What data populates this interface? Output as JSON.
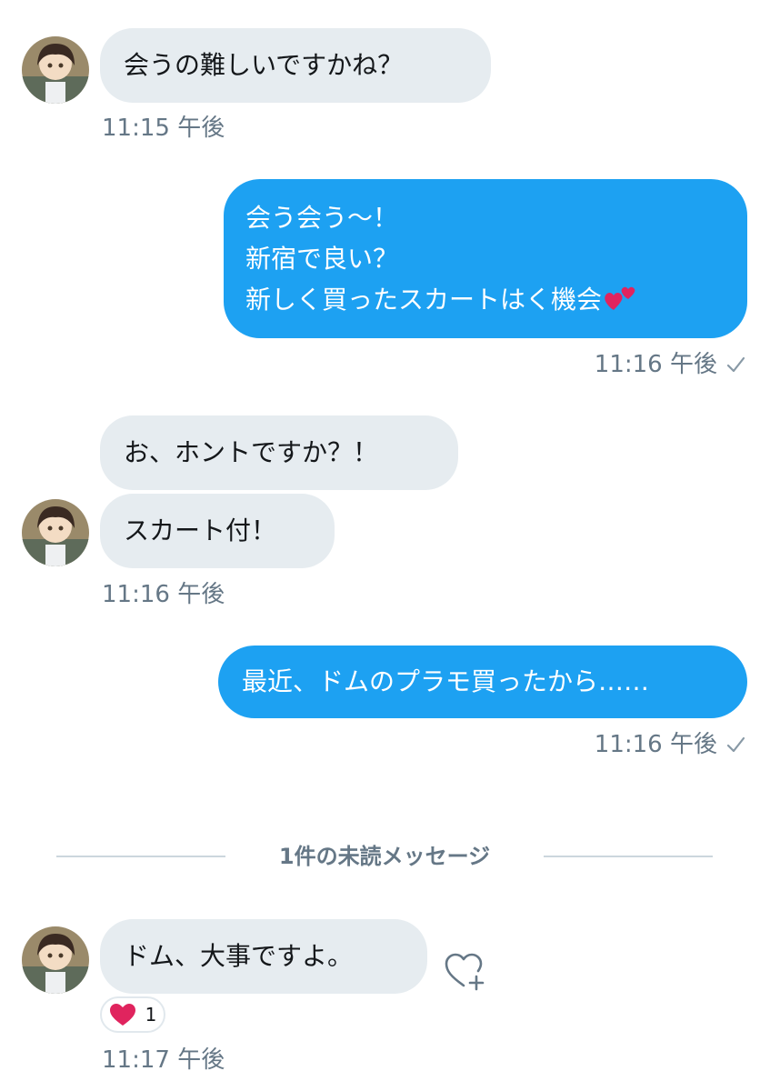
{
  "messages": [
    {
      "text": "会うの難しいですかね？",
      "time": "11:15 午後"
    },
    {
      "lines": [
        "会う会う〜！",
        "新宿で良い？",
        "新しく買ったスカートはく機会"
      ],
      "emoji": "two-hearts",
      "time": "11:16 午後"
    },
    {
      "text": "お、ホントですか？！"
    },
    {
      "text": "スカート付！",
      "time": "11:16 午後"
    },
    {
      "text": "最近、ドムのプラモ買ったから……",
      "time": "11:16 午後"
    },
    {
      "text": "ドム、大事ですよ。",
      "time": "11:17 午後"
    }
  ],
  "unread_divider": "1件の未読メッセージ",
  "reaction": {
    "icon": "heart-icon",
    "count": "1"
  },
  "icons": {
    "read_receipt": "check-icon",
    "add_reaction": "heart-plus-icon",
    "avatar": "avatar-illustration"
  },
  "colors": {
    "incoming_bubble": "#e6ecf0",
    "outgoing_bubble": "#1da1f2",
    "timestamp": "#657786",
    "heart": "#e0245e"
  }
}
